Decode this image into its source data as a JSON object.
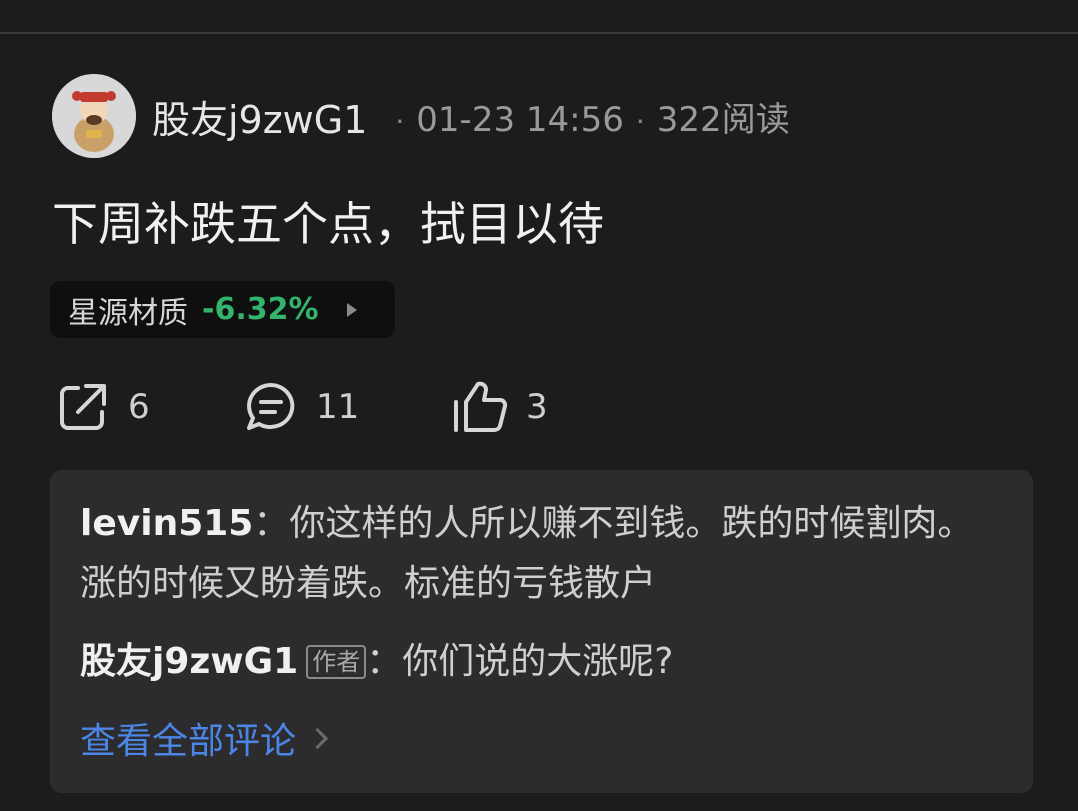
{
  "post": {
    "author": "股友j9zwG1",
    "date": "01-23 14:56",
    "reads": "322阅读",
    "dot": "·",
    "text": "下周补跌五个点，拭目以待"
  },
  "stock": {
    "name": "星源材质",
    "change": "-6.32%",
    "change_color": "#33b36b"
  },
  "actions": {
    "share_count": "6",
    "comment_count": "11",
    "like_count": "3"
  },
  "comments": {
    "c1_user": "levin515",
    "c1_sep": "：",
    "c1_text": "你这样的人所以赚不到钱。跌的时候割肉。涨的时候又盼着跌。标准的亏钱散户",
    "c2_user": "股友j9zwG1",
    "c2_badge": "作者",
    "c2_sep": "：",
    "c2_text": "你们说的大涨呢?",
    "view_all": "查看全部评论"
  },
  "colors": {
    "background": "#1c1c1d",
    "link": "#4b86e6",
    "panel": "#2c2c2e"
  }
}
